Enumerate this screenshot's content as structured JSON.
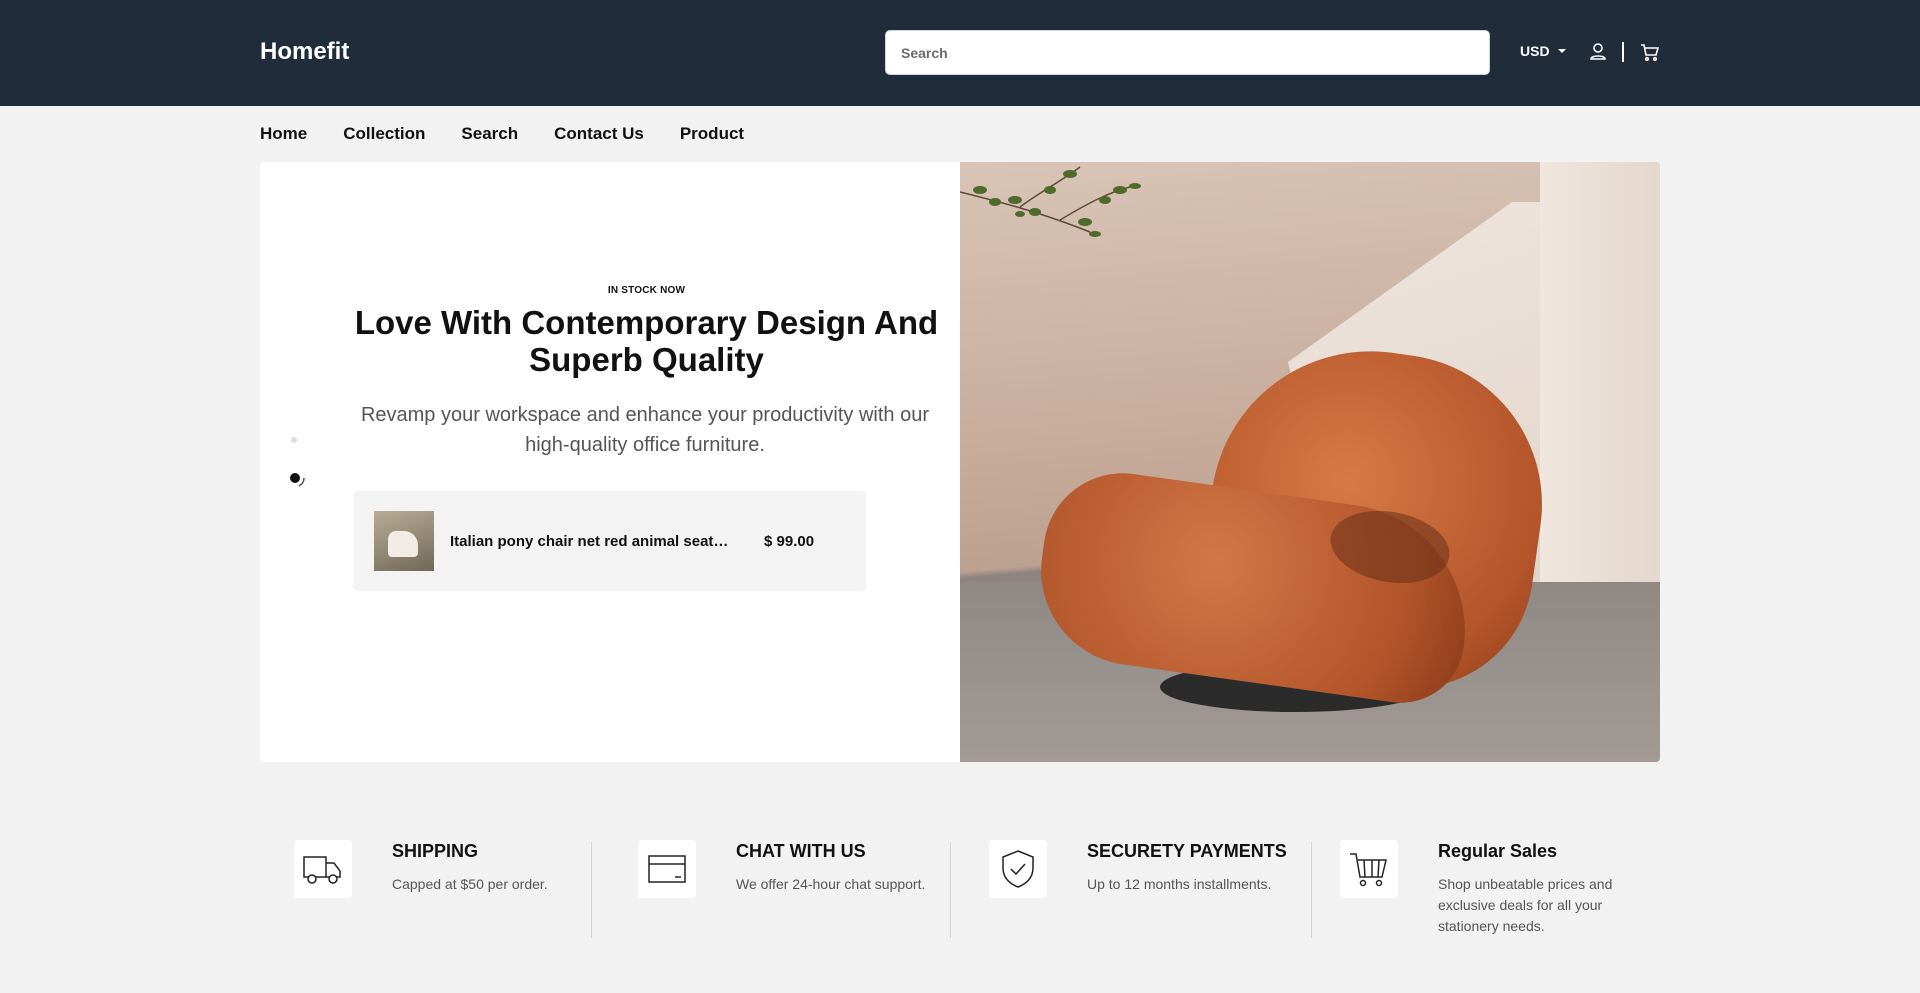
{
  "header": {
    "logo": "Homefit",
    "search_placeholder": "Search",
    "currency": "USD",
    "icons": [
      "account-icon",
      "cart-icon"
    ]
  },
  "nav": {
    "items": [
      "Home",
      "Collection",
      "Search",
      "Contact Us",
      "Product"
    ]
  },
  "hero": {
    "eyebrow": "IN STOCK NOW",
    "headline": "Love With Contemporary Design And Superb Quality",
    "subtext": "Revamp your workspace and enhance your productivity with our high-quality office furniture.",
    "product": {
      "name": "Italian pony chair net red animal seat…",
      "price": "$ 99.00"
    }
  },
  "features": [
    {
      "title": "SHIPPING",
      "desc": "Capped at $50 per order.",
      "icon": "truck-icon"
    },
    {
      "title": "CHAT WITH US",
      "desc": "We offer 24-hour chat support.",
      "icon": "card-icon"
    },
    {
      "title": "SECURETY PAYMENTS",
      "desc": "Up to 12 months installments.",
      "icon": "shield-check-icon"
    },
    {
      "title": "Regular Sales",
      "desc": "Shop unbeatable prices and exclusive deals for all your stationery needs.",
      "icon": "cart-icon"
    }
  ],
  "colors": {
    "header_bg": "#212c3b",
    "page_bg": "#f2f2f2",
    "chair": "#b4552a"
  }
}
